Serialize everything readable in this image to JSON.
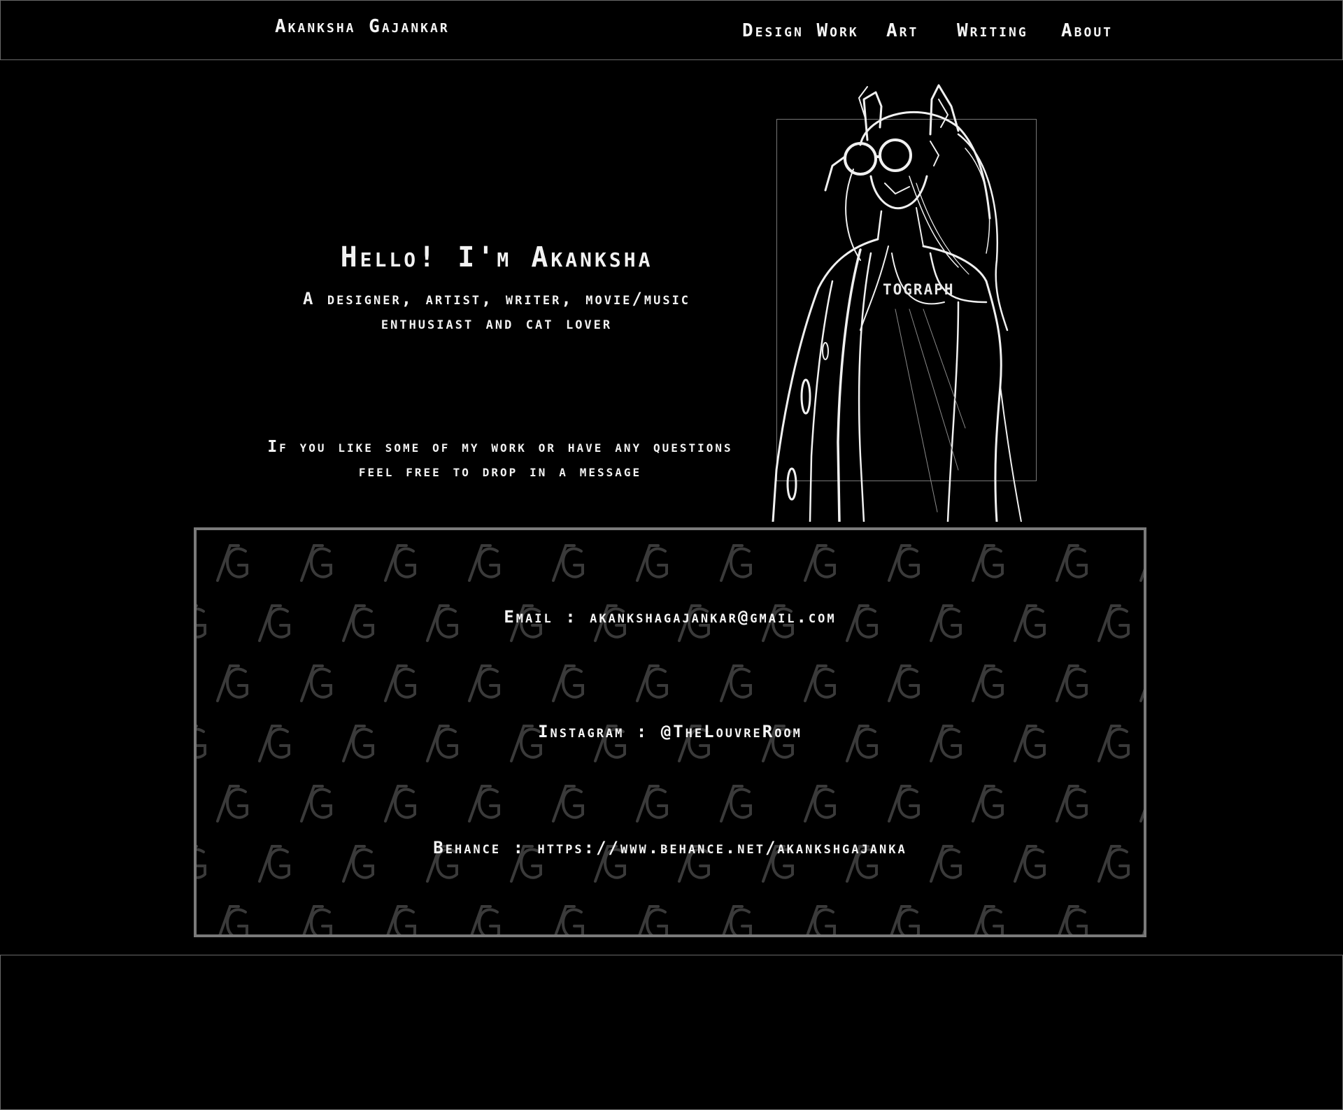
{
  "header": {
    "site_name": "Akanksha Gajankar",
    "nav": [
      {
        "label": "Design Work"
      },
      {
        "label": "Art"
      },
      {
        "label": "Writing"
      },
      {
        "label": "About"
      }
    ]
  },
  "hero": {
    "title": "Hello! I'm Akanksha",
    "subtitle_line1": "A designer, artist, writer, movie/music",
    "subtitle_line2": "enthusiast and cat lover",
    "cta_line1": "If you like some of my work or have any questions",
    "cta_line2": "feel free to drop in a message"
  },
  "illustration": {
    "overlay_text": "TOGRAPH"
  },
  "contact": {
    "pattern_glyph": "AG",
    "email": "Email : akankshagajankar@gmail.com",
    "instagram": "Instagram : @TheLouvreRoom",
    "behance": "Behance : https://www.behance.net/akankshgajanka"
  },
  "colors": {
    "background": "#000000",
    "text": "#f5f5f5",
    "border": "#7a7a7a",
    "pattern": "#3a3a3a"
  }
}
